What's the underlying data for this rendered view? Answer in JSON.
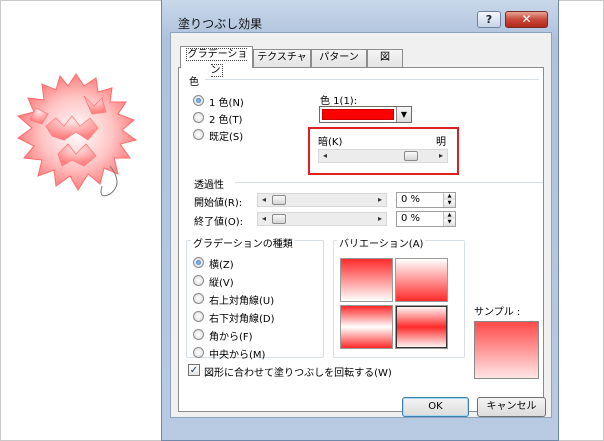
{
  "dialog": {
    "title": "塗りつぶし効果",
    "help_label": "?",
    "close_label": "✕"
  },
  "tabs": [
    {
      "label": "グラデーション",
      "active": true
    },
    {
      "label": "テクスチャ",
      "active": false
    },
    {
      "label": "パターン",
      "active": false
    },
    {
      "label": "図",
      "active": false
    }
  ],
  "color_section": {
    "label": "色",
    "options": [
      {
        "label": "1 色(N)",
        "checked": true
      },
      {
        "label": "2 色(T)",
        "checked": false
      },
      {
        "label": "既定(S)",
        "checked": false
      }
    ],
    "color1_label": "色 1(1):",
    "color1_value": "#ff0000",
    "dark_label": "暗(K)",
    "light_label": "明",
    "shade_level_percent": 80
  },
  "transparency": {
    "label": "透過性",
    "start_label": "開始値(R):",
    "start_value": "0 %",
    "end_label": "終了値(O):",
    "end_value": "0 %"
  },
  "gradient_type": {
    "label": "グラデーションの種類",
    "options": [
      {
        "label": "横(Z)",
        "checked": true
      },
      {
        "label": "縦(V)",
        "checked": false
      },
      {
        "label": "右上対角線(U)",
        "checked": false
      },
      {
        "label": "右下対角線(D)",
        "checked": false
      },
      {
        "label": "角から(F)",
        "checked": false
      },
      {
        "label": "中央から(M)",
        "checked": false
      }
    ]
  },
  "variations": {
    "label": "バリエーション(A)"
  },
  "sample": {
    "label": "サンプル :"
  },
  "rotate_checkbox": {
    "label": "図形に合わせて塗りつぶしを回転する(W)",
    "checked": true
  },
  "buttons": {
    "ok": "OK",
    "cancel": "キャンセル"
  },
  "colors": {
    "accent": "#ff0000",
    "highlight_box": "#e02020",
    "window_frame": "#aec2dc"
  }
}
